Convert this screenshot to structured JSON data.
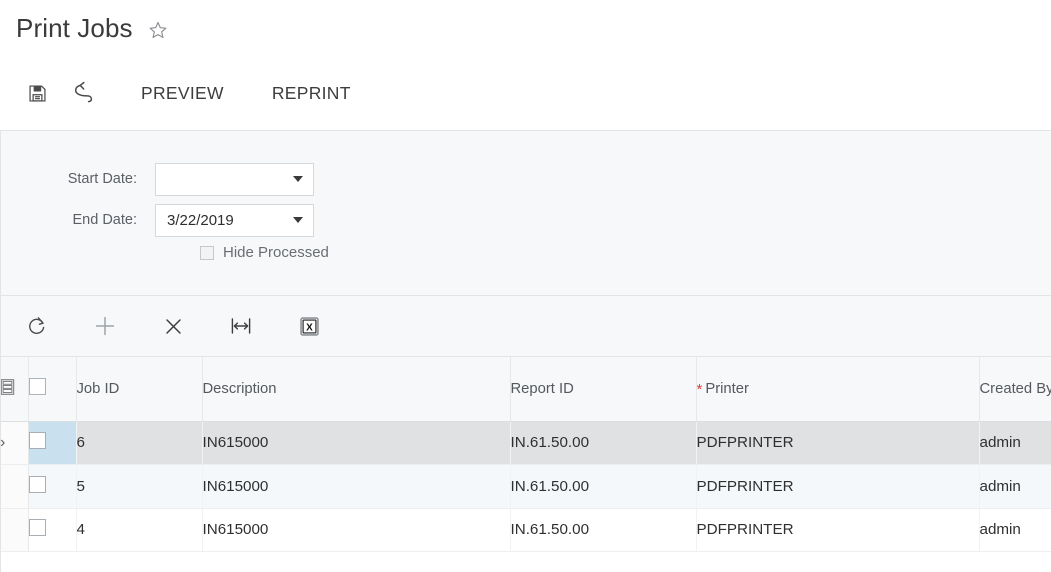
{
  "header": {
    "title": "Print Jobs",
    "favorite_icon": "star-outline-icon"
  },
  "action_toolbar": {
    "save_icon": "save-floppy-icon",
    "undo_icon": "undo-arrow-icon",
    "preview_label": "PREVIEW",
    "reprint_label": "REPRINT"
  },
  "filters": {
    "start_date": {
      "label": "Start Date:",
      "value": "",
      "placeholder": ""
    },
    "end_date": {
      "label": "End Date:",
      "value": "3/22/2019",
      "placeholder": ""
    },
    "hide_processed": {
      "label": "Hide Processed",
      "checked": false,
      "disabled": true
    }
  },
  "grid_toolbar": {
    "buttons": [
      {
        "name": "refresh-icon",
        "label": "Refresh"
      },
      {
        "name": "plus-icon",
        "label": "Add Row"
      },
      {
        "name": "close-x-icon",
        "label": "Delete Row"
      },
      {
        "name": "fit-columns-icon",
        "label": "Adjust Column Widths"
      },
      {
        "name": "excel-export-icon",
        "label": "Export to Excel"
      }
    ]
  },
  "grid": {
    "columns": [
      {
        "key": "icon",
        "label": "",
        "required": false
      },
      {
        "key": "check",
        "label": "",
        "required": false
      },
      {
        "key": "job",
        "label": "Job ID",
        "required": false
      },
      {
        "key": "desc",
        "label": "Description",
        "required": false
      },
      {
        "key": "rep",
        "label": "Report ID",
        "required": false
      },
      {
        "key": "printer",
        "label": "Printer",
        "required": true
      },
      {
        "key": "created",
        "label": "Created By",
        "required": false
      }
    ],
    "rows": [
      {
        "selected": true,
        "job": "6",
        "desc": "IN615000",
        "rep": "IN.61.50.00",
        "printer": "PDFPRINTER",
        "created": "admin"
      },
      {
        "selected": false,
        "job": "5",
        "desc": "IN615000",
        "rep": "IN.61.50.00",
        "printer": "PDFPRINTER",
        "created": "admin"
      },
      {
        "selected": false,
        "job": "4",
        "desc": "IN615000",
        "rep": "IN.61.50.00",
        "printer": "PDFPRINTER",
        "created": "admin"
      }
    ],
    "row_indicator_glyph": "›"
  },
  "colors": {
    "panel_bg": "#f7f8f9",
    "border": "#e2e4e6",
    "selected_row": "#e0e1e2",
    "selected_checkcell": "#c9e0ef",
    "alt_row": "#f4f8fa",
    "required_star": "#e03a3a",
    "text": "#2f2f2f"
  }
}
